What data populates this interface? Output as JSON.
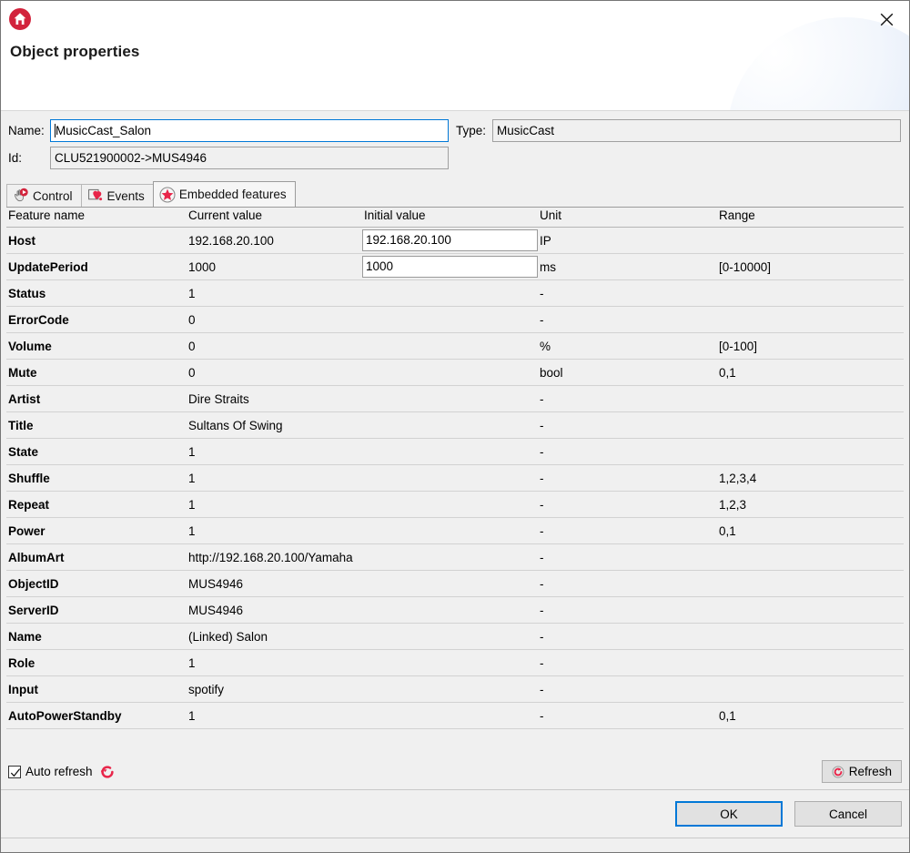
{
  "window": {
    "title": "Object properties",
    "home_icon": "home-icon",
    "close_icon": "close-icon"
  },
  "fields": {
    "name_label": "Name:",
    "name_value": "MusicCast_Salon",
    "id_label": "Id:",
    "id_value": "CLU521900002->MUS4946",
    "type_label": "Type:",
    "type_value": "MusicCast"
  },
  "tabs": [
    {
      "label": "Control",
      "icon": "hand-cursor-icon",
      "selected": false
    },
    {
      "label": "Events",
      "icon": "event-flag-icon",
      "selected": false
    },
    {
      "label": "Embedded features",
      "icon": "star-circle-icon",
      "selected": true
    }
  ],
  "table": {
    "headers": [
      "Feature name",
      "Current value",
      "Initial value",
      "Unit",
      "Range"
    ],
    "rows": [
      {
        "name": "Host",
        "current": "192.168.20.100",
        "initial": "192.168.20.100",
        "has_input": true,
        "unit": "IP",
        "range": ""
      },
      {
        "name": "UpdatePeriod",
        "current": "1000",
        "initial": "1000",
        "has_input": true,
        "unit": "ms",
        "range": "[0-10000]"
      },
      {
        "name": "Status",
        "current": "1",
        "initial": "",
        "has_input": false,
        "unit": "-",
        "range": ""
      },
      {
        "name": "ErrorCode",
        "current": "0",
        "initial": "",
        "has_input": false,
        "unit": "-",
        "range": ""
      },
      {
        "name": "Volume",
        "current": "0",
        "initial": "",
        "has_input": false,
        "unit": "%",
        "range": "[0-100]"
      },
      {
        "name": "Mute",
        "current": "0",
        "initial": "",
        "has_input": false,
        "unit": "bool",
        "range": "0,1"
      },
      {
        "name": "Artist",
        "current": "Dire Straits",
        "initial": "",
        "has_input": false,
        "unit": "-",
        "range": ""
      },
      {
        "name": "Title",
        "current": "Sultans Of Swing",
        "initial": "",
        "has_input": false,
        "unit": "-",
        "range": ""
      },
      {
        "name": "State",
        "current": "1",
        "initial": "",
        "has_input": false,
        "unit": "-",
        "range": ""
      },
      {
        "name": "Shuffle",
        "current": "1",
        "initial": "",
        "has_input": false,
        "unit": "-",
        "range": "1,2,3,4"
      },
      {
        "name": "Repeat",
        "current": "1",
        "initial": "",
        "has_input": false,
        "unit": "-",
        "range": "1,2,3"
      },
      {
        "name": "Power",
        "current": "1",
        "initial": "",
        "has_input": false,
        "unit": "-",
        "range": "0,1"
      },
      {
        "name": "AlbumArt",
        "current": "http://192.168.20.100/Yamaha",
        "initial": "",
        "has_input": false,
        "unit": "-",
        "range": ""
      },
      {
        "name": "ObjectID",
        "current": "MUS4946",
        "initial": "",
        "has_input": false,
        "unit": "-",
        "range": ""
      },
      {
        "name": "ServerID",
        "current": "MUS4946",
        "initial": "",
        "has_input": false,
        "unit": "-",
        "range": ""
      },
      {
        "name": "Name",
        "current": "(Linked) Salon",
        "initial": "",
        "has_input": false,
        "unit": "-",
        "range": ""
      },
      {
        "name": "Role",
        "current": "1",
        "initial": "",
        "has_input": false,
        "unit": "-",
        "range": ""
      },
      {
        "name": "Input",
        "current": "spotify",
        "initial": "",
        "has_input": false,
        "unit": "-",
        "range": ""
      },
      {
        "name": "AutoPowerStandby",
        "current": "1",
        "initial": "",
        "has_input": false,
        "unit": "-",
        "range": "0,1"
      }
    ]
  },
  "footer": {
    "auto_refresh_label": "Auto refresh",
    "auto_refresh_checked": true,
    "refresh_label": "Refresh",
    "refresh_icon": "refresh-icon",
    "ok_label": "OK",
    "cancel_label": "Cancel"
  },
  "colors": {
    "accent_red": "#d2233c",
    "focus_blue": "#0078d7",
    "window_bg": "#f0f0f0",
    "header_bg": "#ffffff"
  }
}
